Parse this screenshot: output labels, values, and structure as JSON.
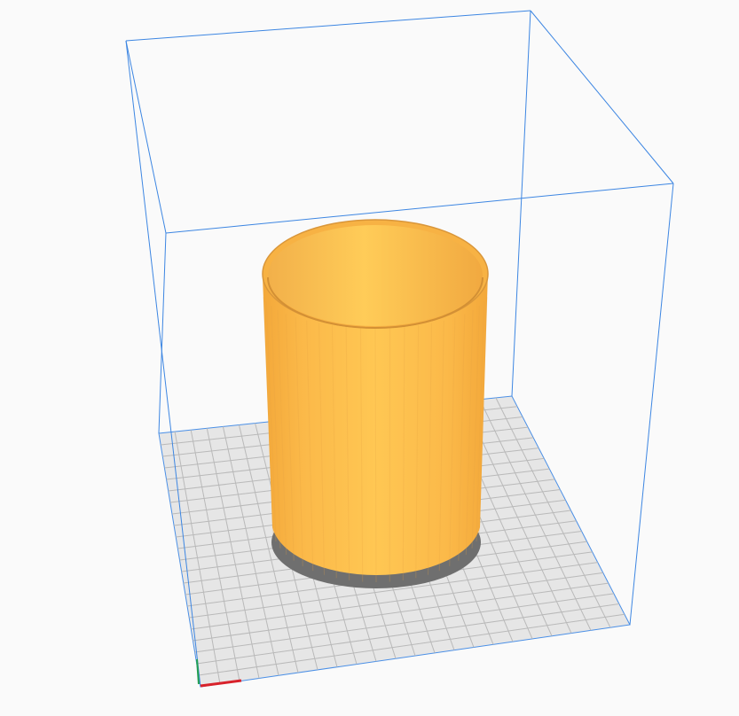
{
  "viewport": {
    "background": "#fafafa",
    "build_volume_color": "#2f7fe0",
    "plate_fill": "#e6e6e6",
    "plate_grid_color": "#b9b9b9",
    "model_color": "#ffc24f",
    "model_dark": "#f4aa3a",
    "model_shadow": "#6e6e6e",
    "axis_x_color": "#d8222b",
    "axis_y_color": "#22a050",
    "grid_divisions": 22,
    "model_shape": "hollow cylinder"
  }
}
